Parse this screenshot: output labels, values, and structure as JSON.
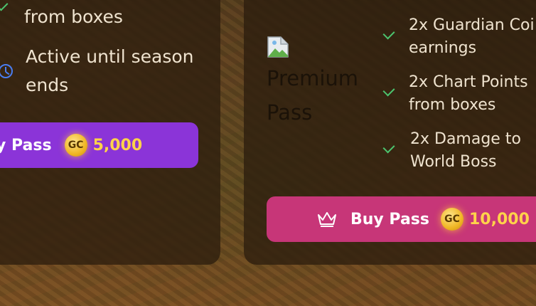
{
  "left_card": {
    "partial_feature": "from boxes",
    "active_feature": "Active until season ends",
    "buy": {
      "label": "y Pass",
      "coin": "GC",
      "price": "5,000"
    }
  },
  "right_card": {
    "title": "Premium Pass",
    "features": [
      "2x Guardian Coi earnings",
      "2x Chart Points from boxes",
      "2x Damage to World Boss"
    ],
    "buy": {
      "label": "Buy Pass",
      "coin": "GC",
      "price": "10,000"
    }
  },
  "colors": {
    "check": "#4cc46e",
    "clock": "#4a7df0",
    "button_purple": "#8b34d8",
    "button_pink": "#c73678",
    "price_gold": "#ffd24a"
  },
  "icons": [
    "check-icon",
    "clock-icon",
    "crown-icon",
    "gold-coin-icon",
    "broken-image-icon"
  ]
}
